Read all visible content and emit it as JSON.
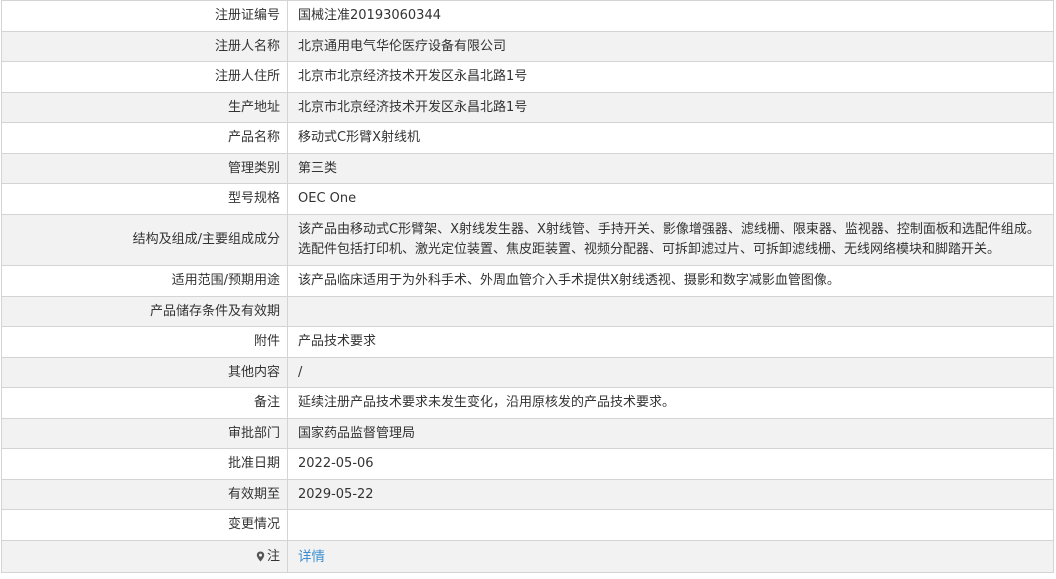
{
  "rows": [
    {
      "label": "注册证编号",
      "value": "国械注准20193060344"
    },
    {
      "label": "注册人名称",
      "value": "北京通用电气华伦医疗设备有限公司"
    },
    {
      "label": "注册人住所",
      "value": "北京市北京经济技术开发区永昌北路1号"
    },
    {
      "label": "生产地址",
      "value": "北京市北京经济技术开发区永昌北路1号"
    },
    {
      "label": "产品名称",
      "value": "移动式C形臂X射线机"
    },
    {
      "label": "管理类别",
      "value": "第三类"
    },
    {
      "label": "型号规格",
      "value": "OEC One"
    },
    {
      "label": "结构及组成/主要组成成分",
      "value": "该产品由移动式C形臂架、X射线发生器、X射线管、手持开关、影像增强器、滤线栅、限束器、监视器、控制面板和选配件组成。选配件包括打印机、激光定位装置、焦皮距装置、视频分配器、可拆卸滤过片、可拆卸滤线栅、无线网络模块和脚踏开关。"
    },
    {
      "label": "适用范围/预期用途",
      "value": "该产品临床适用于为外科手术、外周血管介入手术提供X射线透视、摄影和数字减影血管图像。"
    },
    {
      "label": "产品储存条件及有效期",
      "value": ""
    },
    {
      "label": "附件",
      "value": "产品技术要求"
    },
    {
      "label": "其他内容",
      "value": "/"
    },
    {
      "label": "备注",
      "value": "延续注册产品技术要求未发生变化，沿用原核发的产品技术要求。"
    },
    {
      "label": "审批部门",
      "value": "国家药品监督管理局"
    },
    {
      "label": "批准日期",
      "value": "2022-05-06"
    },
    {
      "label": "有效期至",
      "value": "2029-05-22"
    },
    {
      "label": "变更情况",
      "value": ""
    }
  ],
  "note_row": {
    "label": "注",
    "icon": "map-pin-icon",
    "link_text": "详情",
    "link_color": "#3d8ed0"
  }
}
